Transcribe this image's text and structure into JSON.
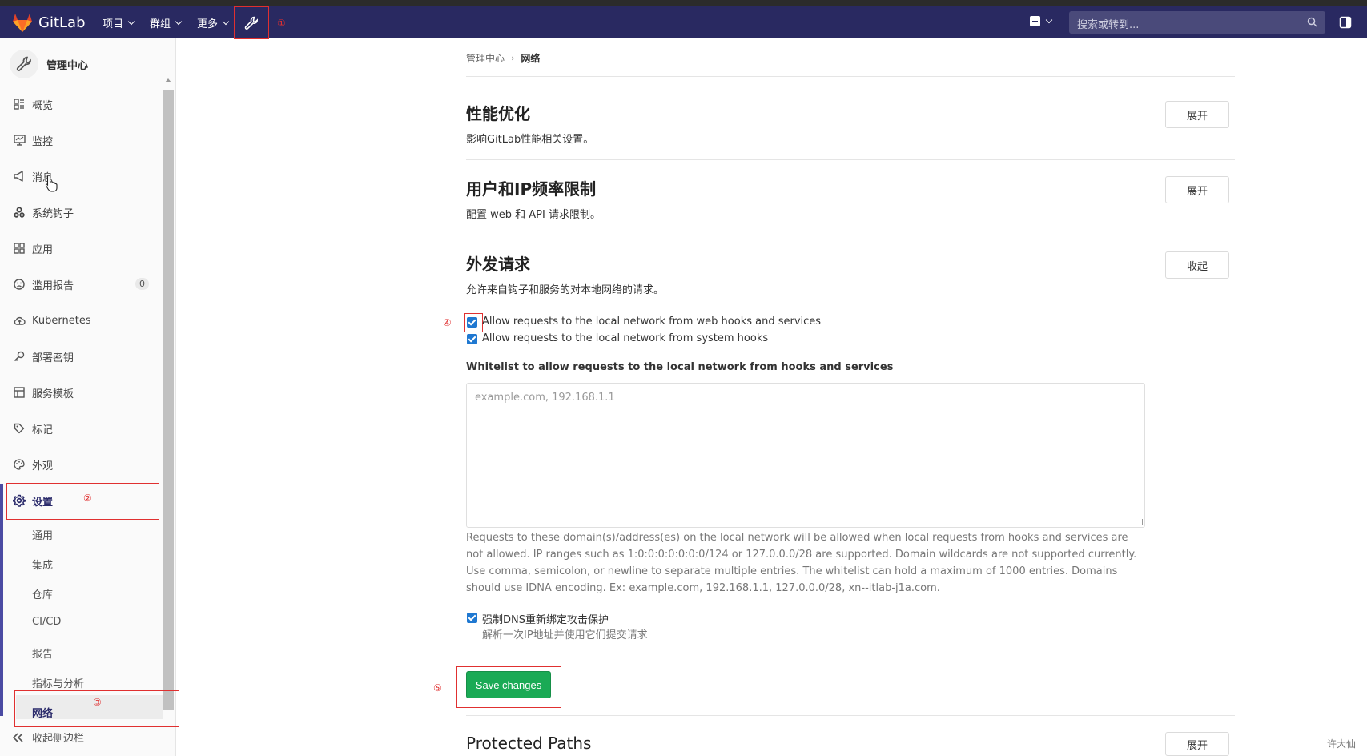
{
  "navbar": {
    "brand": "GitLab",
    "menus": [
      {
        "label": "项目"
      },
      {
        "label": "群组"
      },
      {
        "label": "更多"
      }
    ],
    "search_placeholder": "搜索或转到...",
    "annotation": "①"
  },
  "sidebar": {
    "title": "管理中心",
    "items": [
      {
        "label": "概览",
        "icon": "overview-icon"
      },
      {
        "label": "监控",
        "icon": "monitor-icon"
      },
      {
        "label": "消息",
        "icon": "broadcast-icon"
      },
      {
        "label": "系统钩子",
        "icon": "hook-icon"
      },
      {
        "label": "应用",
        "icon": "apps-icon"
      },
      {
        "label": "滥用报告",
        "icon": "abuse-icon",
        "badge": "0"
      },
      {
        "label": "Kubernetes",
        "icon": "cloud-icon"
      },
      {
        "label": "部署密钥",
        "icon": "key-icon"
      },
      {
        "label": "服务模板",
        "icon": "template-icon"
      },
      {
        "label": "标记",
        "icon": "label-icon"
      },
      {
        "label": "外观",
        "icon": "palette-icon"
      }
    ],
    "settings": {
      "label": "设置",
      "annotation": "②"
    },
    "sub_items": [
      {
        "label": "通用"
      },
      {
        "label": "集成"
      },
      {
        "label": "仓库"
      },
      {
        "label": "CI/CD"
      },
      {
        "label": "报告"
      },
      {
        "label": "指标与分析"
      },
      {
        "label": "网络",
        "annotation": "③"
      }
    ],
    "collapse_label": "收起侧边栏"
  },
  "breadcrumb": {
    "parent": "管理中心",
    "current": "网络"
  },
  "sections": [
    {
      "title": "性能优化",
      "desc": "影响GitLab性能相关设置。",
      "button": "展开"
    },
    {
      "title": "用户和IP频率限制",
      "desc": "配置 web 和 API 请求限制。",
      "button": "展开"
    },
    {
      "title": "外发请求",
      "desc": "允许来自钩子和服务的对本地网络的请求。",
      "button": "收起"
    }
  ],
  "outbound": {
    "annotation_checkbox": "④",
    "cb_webhooks": "Allow requests to the local network from web hooks and services",
    "cb_system_hooks": "Allow requests to the local network from system hooks",
    "whitelist_label": "Whitelist to allow requests to the local network from hooks and services",
    "whitelist_placeholder": "example.com, 192.168.1.1",
    "help": "Requests to these domain(s)/address(es) on the local network will be allowed when local requests from hooks and services are not allowed. IP ranges such as 1:0:0:0:0:0:0:0/124 or 127.0.0.0/28 are supported. Domain wildcards are not supported currently. Use comma, semicolon, or newline to separate multiple entries. The whitelist can hold a maximum of 1000 entries. Domains should use IDNA encoding. Ex: example.com, 192.168.1.1, 127.0.0.0/28, xn--itlab-j1a.com.",
    "cb_dns": "强制DNS重新绑定攻击保护",
    "dns_sub": "解析一次IP地址并使用它们提交请求",
    "save": "Save changes",
    "annotation_save": "⑤"
  },
  "protected": {
    "title": "Protected Paths",
    "button": "展开"
  },
  "watermark": "许大仙",
  "colors": {
    "navbar": "#292961",
    "save": "#1aaa55",
    "annotation": "#e03030",
    "checkbox": "#1f78d1"
  }
}
